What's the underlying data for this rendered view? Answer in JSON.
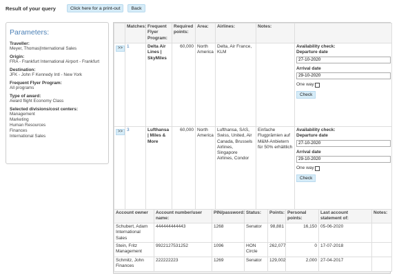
{
  "header": {
    "title": "Result of your query",
    "print_label": "Click here for a print-out",
    "back_label": "Back"
  },
  "parameters": {
    "title": "Parameters:",
    "items": [
      {
        "label": "Traveller:",
        "value": "Meyer, Thomas|International Sales"
      },
      {
        "label": "Origin:",
        "value": "FRA - Frankfurt International Airport - Frankfurt"
      },
      {
        "label": "Destination:",
        "value": "JFK - John F Kennedy Intl - New York"
      },
      {
        "label": "Frequent Flyer Program:",
        "value": "All programs"
      },
      {
        "label": "Type of award:",
        "value": "Award flight Economy Class"
      },
      {
        "label": "Selected divisions/cost centers:",
        "value": "Management\nMarketing\nHuman Resources\nFinances\nInternational Sales"
      }
    ]
  },
  "results": {
    "columns": [
      "",
      "Matches:",
      "Frequent Flyer Program:",
      "Required points:",
      "Area:",
      "Airlines:",
      "Notes:",
      ""
    ],
    "rows": [
      {
        "expand": ">>",
        "match": "1",
        "program": "Delta Air Lines | SkyMiles",
        "points": "60,000",
        "area": "North America",
        "airlines": "Delta, Air France, KLM",
        "notes": "",
        "availability_label": "Availability check:",
        "departure_label": "Departure date",
        "departure": "27-10-2020",
        "arrival_label": "Arrival date",
        "arrival": "29-10-2020",
        "oneway_label": "One way",
        "check_label": "Check"
      },
      {
        "expand": ">>",
        "match": "3",
        "program": "Lufthansa | Miles & More",
        "points": "60,000",
        "area": "North America",
        "airlines": "Lufthansa, SAS, Swiss, United, Air Canada, Brussels Airlines, Singapore Airlines, Condor",
        "notes": "Einfache Flugprämien auf M&M-Anbietern für 50% erhältlich",
        "availability_label": "Availability check:",
        "departure_label": "Departure date",
        "departure": "27-10-2020",
        "arrival_label": "Arrival date",
        "arrival": "29-10-2020",
        "oneway_label": "One way",
        "check_label": "Check"
      }
    ]
  },
  "accounts": {
    "columns": [
      "Account owner",
      "Account number/user name:",
      "PIN/password:",
      "Status:",
      "Points:",
      "Personal points:",
      "Last account statement of:",
      "Notes:"
    ],
    "rows": [
      {
        "owner": "Schubert, Adam International Sales",
        "number": "444444444443",
        "pin": "1268",
        "status": "Senator",
        "points": "98,881",
        "personal": "16,150",
        "statement": "05-06-2020",
        "notes": ""
      },
      {
        "owner": "Stein, Fritz Management",
        "number": "9922127531252",
        "pin": "1096",
        "status": "HON Circle",
        "points": "262,077",
        "personal": "0",
        "statement": "17-07-2018",
        "notes": ""
      },
      {
        "owner": "Schmitz, John Finances",
        "number": "222222223",
        "pin": "1269",
        "status": "Senator",
        "points": "129,002",
        "personal": "2,000",
        "statement": "27-04-2017",
        "notes": ""
      }
    ]
  }
}
